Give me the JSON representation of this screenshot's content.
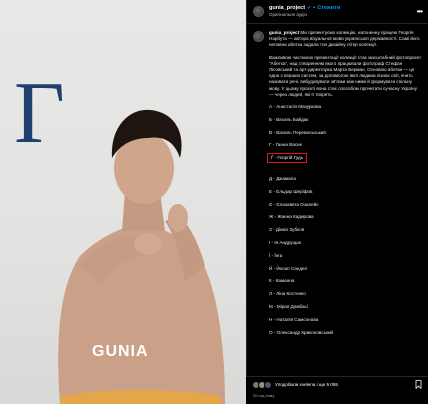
{
  "photo": {
    "letter": "Г",
    "brand": "GUNIA"
  },
  "post": {
    "username": "gunia_project",
    "verified_icon": "verified-badge-icon",
    "separator": "•",
    "follow_label": "Стежити",
    "audio_label": "Оригінальне аудіо",
    "more_icon": "more-options-icon"
  },
  "caption": {
    "username": "gunia_project",
    "intro": "Ми презентуємо колекцію, натхненну працею Георгія Нарбута — автора візуальної мови української державності. Самі його неповна абетка задала тон дизайну літер колекції.",
    "body": "Важливою частиною презентації колекції стає масштабний фотопроєкт \"Абетка\", над створенням якого працювали фотограф Стефан Лісовський та арт-директорка Марта Берман. Основою абетки — це одна з перших систем, за допомогою якої людина пізнає світ, вчить називати речі, вибудовувати зв'язки між ними й формувати спільну мову. У цьому проєкті вона стає способом прочитати сучасну Україну — через людей, які її творять.",
    "items": [
      "А - Анастасія Мазуркова",
      "Б - Василь Байдак",
      "В - Василь Перевальський",
      "Г - Ганна Васик",
      "Ґ - Георгій Гудь",
      "Д - Джамала",
      "Е - Ельдар Шеріфов",
      "Є - Єлизавета Озалейє",
      "Ж - Жанна Кадирова",
      "З - Дінкіо Зубков",
      "І - Ія Андрущак",
      "Ї - Їнга",
      "Й - Йосип Сандел",
      "К - Каманна",
      "Л - Ліна Костенко",
      "М - Мірая Домбасі",
      "Н - Наталія Самсонова",
      "О - Олександр Криконовський"
    ],
    "highlighted_index": 4
  },
  "footer": {
    "likes_text": "Уподобали xvelena і ще 5 055",
    "date": "20 год тому",
    "bookmark_icon": "bookmark-icon"
  },
  "colors": {
    "letter": "#1f3f6e",
    "accent": "#0095f6",
    "highlight": "#e0141e"
  }
}
